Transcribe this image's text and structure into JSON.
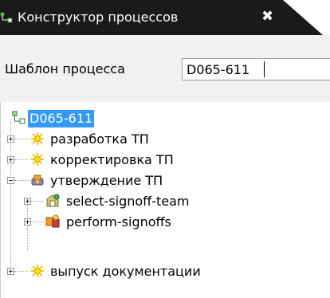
{
  "tab": {
    "title": "Конструктор процессов",
    "close_label": "✖",
    "icon": "process-constructor-icon"
  },
  "template": {
    "label": "Шаблон процесса",
    "value": "D065-611"
  },
  "tree": {
    "root": {
      "label": "D065-611",
      "icon": "process-tree-icon"
    },
    "nodes": [
      {
        "label": "разработка ТП",
        "icon": "sun-task-icon",
        "expander": "plus"
      },
      {
        "label": "корректировка ТП",
        "icon": "sun-task-icon",
        "expander": "plus"
      },
      {
        "label": "утверждение ТП",
        "icon": "review-task-icon",
        "expander": "minus"
      },
      {
        "label": "select-signoff-team",
        "icon": "signoff-team-icon",
        "expander": "plus"
      },
      {
        "label": "perform-signoffs",
        "icon": "perform-signoffs-icon",
        "expander": "plus"
      },
      {
        "label": "выпуск документации",
        "icon": "sun-task-icon",
        "expander": "plus"
      }
    ]
  },
  "colors": {
    "tab_bg": "#1a1a1a",
    "selection": "#3399ff"
  }
}
